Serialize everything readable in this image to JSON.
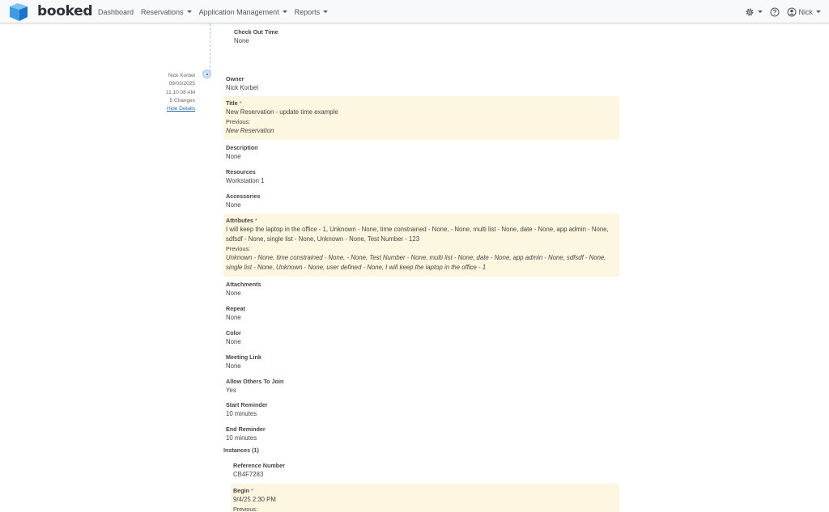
{
  "brand": {
    "name": "booked",
    "color": "#3f9be5"
  },
  "nav": {
    "dashboard": "Dashboard",
    "reservations": "Reservations",
    "app_management": "Application Management",
    "reports": "Reports"
  },
  "user": {
    "name": "Nick"
  },
  "header_field": {
    "label": "Check Out Time",
    "value": "None"
  },
  "entry": {
    "author": "Nick Korbel",
    "date": "09/03/2025",
    "time": "11:10:08 AM",
    "changes": "5 Changes",
    "hide_details": "Hide Details"
  },
  "asterisk": "*",
  "previous_label": "Previous:",
  "fields": {
    "owner": {
      "label": "Owner",
      "value": "Nick Korbel"
    },
    "title": {
      "label": "Title",
      "value": "New Reservation - update time example",
      "previous": "New Reservation"
    },
    "description": {
      "label": "Description",
      "value": "None"
    },
    "resources": {
      "label": "Resources",
      "value": "Workstation 1"
    },
    "accessories": {
      "label": "Accessories",
      "value": "None"
    },
    "attributes": {
      "label": "Attributes",
      "value": "I will keep the laptop in the office - 1, Unknown - None, time constrained - None, - None, multi list - None, date - None, app admin - None, sdfsdf - None, single list - None, Unknown - None, Test Number - 123",
      "previous": "Unknown - None, time constrained - None, - None, Test Number - None, multi list - None, date - None, app admin - None, sdfsdf - None, single list - None, Unknown - None, user defined - None, I will keep the laptop in the office - 1"
    },
    "attachments": {
      "label": "Attachments",
      "value": "None"
    },
    "repeat": {
      "label": "Repeat",
      "value": "None"
    },
    "color": {
      "label": "Color",
      "value": "None"
    },
    "meeting_link": {
      "label": "Meeting Link",
      "value": "None"
    },
    "allow_others": {
      "label": "Allow Others To Join",
      "value": "Yes"
    },
    "start_reminder": {
      "label": "Start Reminder",
      "value": "10 minutes"
    },
    "end_reminder": {
      "label": "End Reminder",
      "value": "10 minutes"
    }
  },
  "instances": {
    "title": "Instances (1)",
    "reference": {
      "label": "Reference Number",
      "value": "CB4F7283"
    },
    "begin": {
      "label": "Begin",
      "value": "9/4/25 2:30 PM"
    }
  },
  "colors": {
    "changed_bg": "#fdf6e0",
    "link": "#2a6ca8"
  }
}
